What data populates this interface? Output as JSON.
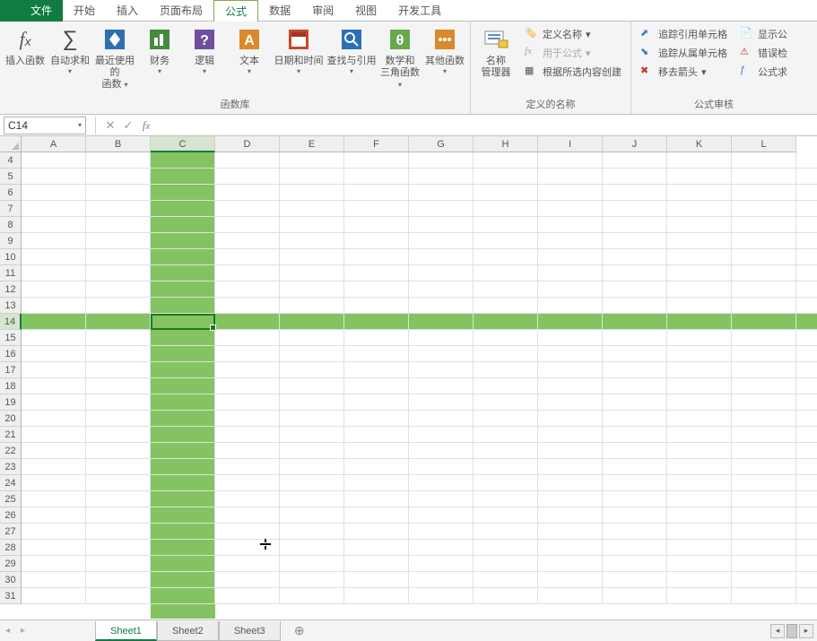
{
  "menu": {
    "tabs": [
      "文件",
      "开始",
      "插入",
      "页面布局",
      "公式",
      "数据",
      "审阅",
      "视图",
      "开发工具"
    ],
    "active_index": 4
  },
  "ribbon": {
    "insert_fn": "插入函数",
    "autosum": "自动求和",
    "recent_line1": "最近使用的",
    "recent_line2": "函数",
    "financial": "财务",
    "logical": "逻辑",
    "text": "文本",
    "datetime": "日期和时间",
    "lookup": "查找与引用",
    "math_line1": "数学和",
    "math_line2": "三角函数",
    "other": "其他函数",
    "group1_label": "函数库",
    "name_mgr_line1": "名称",
    "name_mgr_line2": "管理器",
    "define_name": "定义名称",
    "use_in_formula": "用于公式",
    "create_from_sel": "根据所选内容创建",
    "group2_label": "定义的名称",
    "trace_precedents": "追踪引用单元格",
    "trace_dependents": "追踪从属单元格",
    "remove_arrows": "移去箭头",
    "show_formulas": "显示公",
    "error_check": "错误检",
    "eval_formula": "公式求",
    "group3_label": "公式审核"
  },
  "namebox": {
    "value": "C14"
  },
  "formula_input": {
    "value": ""
  },
  "grid": {
    "columns": [
      "A",
      "B",
      "C",
      "D",
      "E",
      "F",
      "G",
      "H",
      "I",
      "J",
      "K",
      "L"
    ],
    "row_start": 4,
    "row_end": 31,
    "selected_col_index": 2,
    "selected_row_value": 14,
    "fill_color": "#84c361"
  },
  "sheets": {
    "tabs": [
      "Sheet1",
      "Sheet2",
      "Sheet3"
    ],
    "active_index": 0
  }
}
